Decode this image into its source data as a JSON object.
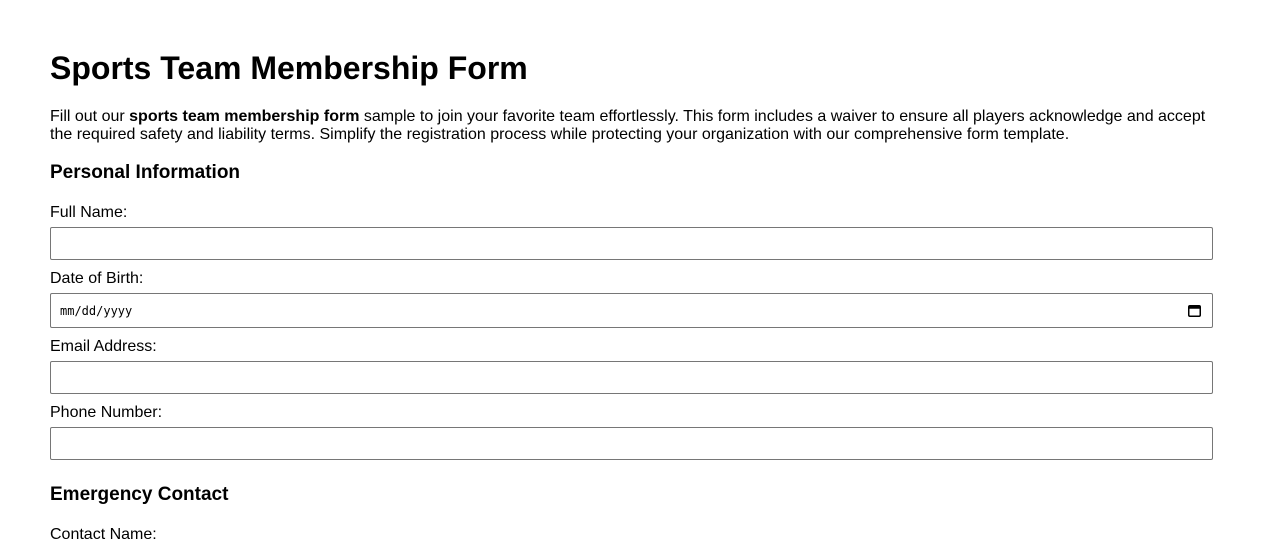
{
  "header": {
    "title": "Sports Team Membership Form"
  },
  "intro": {
    "prefix": "Fill out our ",
    "emphasis": "sports team membership form",
    "suffix": " sample to join your favorite team effortlessly. This form includes a waiver to ensure all players acknowledge and accept the required safety and liability terms. Simplify the registration process while protecting your organization with our comprehensive form template."
  },
  "personal": {
    "heading": "Personal Information",
    "full_name_label": "Full Name:",
    "full_name_value": "",
    "dob_label": "Date of Birth:",
    "dob_placeholder": "mm/dd/yyyy",
    "email_label": "Email Address:",
    "email_value": "",
    "phone_label": "Phone Number:",
    "phone_value": ""
  },
  "emergency": {
    "heading": "Emergency Contact",
    "contact_name_label": "Contact Name:"
  },
  "icons": {
    "date_picker": "calendar-icon"
  }
}
